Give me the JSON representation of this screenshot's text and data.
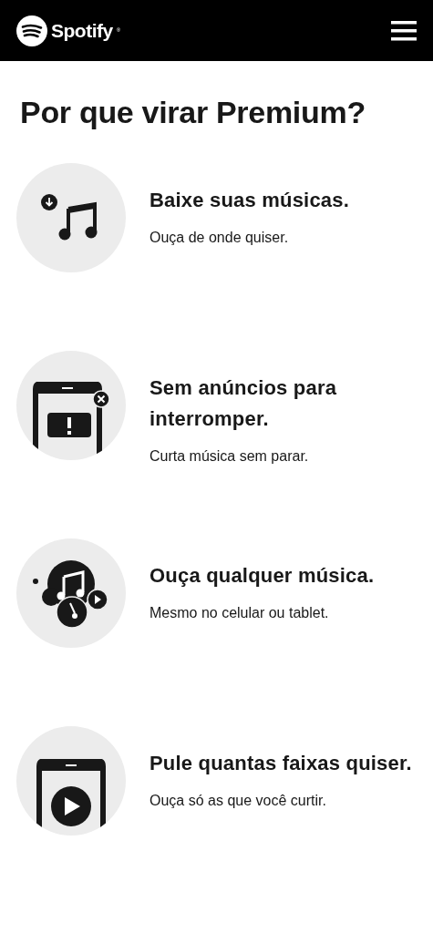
{
  "header": {
    "brand": "Spotify",
    "trademark": "®"
  },
  "heading": "Por que virar Premium?",
  "features": [
    {
      "title": "Baixe suas músicas.",
      "subtitle": "Ouça de onde quiser."
    },
    {
      "title": "Sem anúncios para interromper.",
      "subtitle": "Curta música sem parar."
    },
    {
      "title": "Ouça qualquer música.",
      "subtitle": "Mesmo no celular ou tablet."
    },
    {
      "title": "Pule quantas faixas quiser.",
      "subtitle": "Ouça só as que você curtir."
    }
  ]
}
